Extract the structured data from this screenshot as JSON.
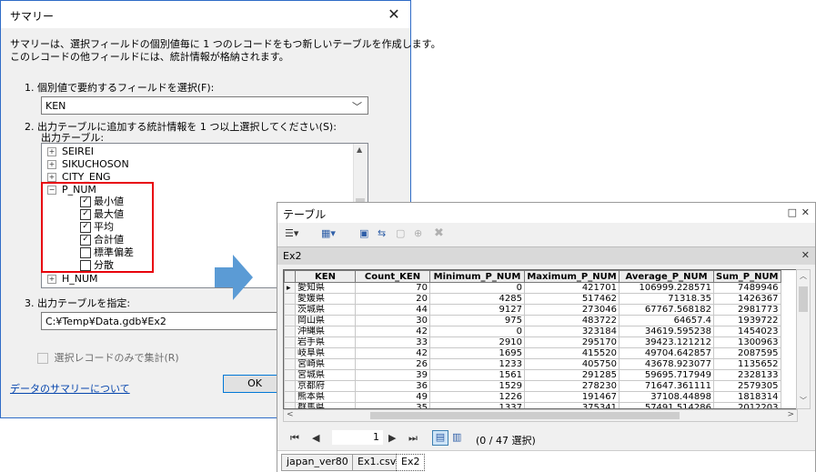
{
  "dialog": {
    "title": "サマリー",
    "desc_line1": "サマリーは、選択フィールドの個別値毎に 1 つのレコードをもつ新しいテーブルを作成します。",
    "desc_line2": "このレコードの他フィールドには、統計情報が格納されます。",
    "step1_label": "1. 個別値で要約するフィールドを選択(F):",
    "step1_value": "KEN",
    "step2_label": "2. 出力テーブルに追加する統計情報を 1 つ以上選択してください(S):",
    "step2_sublabel": "出力テーブル:",
    "tree": [
      {
        "label": "SEIREI",
        "expanded": false
      },
      {
        "label": "SIKUCHOSON",
        "expanded": false
      },
      {
        "label": "CITY_ENG",
        "expanded": false
      },
      {
        "label": "P_NUM",
        "expanded": true
      },
      {
        "label": "H_NUM",
        "expanded": false
      }
    ],
    "stats": [
      {
        "label": "最小値",
        "checked": true
      },
      {
        "label": "最大値",
        "checked": true
      },
      {
        "label": "平均",
        "checked": true
      },
      {
        "label": "合計値",
        "checked": true
      },
      {
        "label": "標準偏差",
        "checked": false
      },
      {
        "label": "分散",
        "checked": false
      }
    ],
    "step3_label": "3. 出力テーブルを指定:",
    "step3_value": "C:¥Temp¥Data.gdb¥Ex2",
    "selected_only_label": "選択レコードのみで集計(R)",
    "help_link": "データのサマリーについて",
    "ok_label": "OK",
    "highlight_color": "#e8000b"
  },
  "table_window": {
    "title": "テーブル",
    "tab_name": "Ex2",
    "columns": [
      "KEN",
      "Count_KEN",
      "Minimum_P_NUM",
      "Maximum_P_NUM",
      "Average_P_NUM",
      "Sum_P_NUM"
    ],
    "rows": [
      [
        "愛知県",
        "70",
        "0",
        "421701",
        "106999.228571",
        "7489946"
      ],
      [
        "愛媛県",
        "20",
        "4285",
        "517462",
        "71318.35",
        "1426367"
      ],
      [
        "茨城県",
        "44",
        "9127",
        "273046",
        "67767.568182",
        "2981773"
      ],
      [
        "岡山県",
        "30",
        "975",
        "483722",
        "64657.4",
        "1939722"
      ],
      [
        "沖縄県",
        "42",
        "0",
        "323184",
        "34619.595238",
        "1454023"
      ],
      [
        "岩手県",
        "33",
        "2910",
        "295170",
        "39423.121212",
        "1300963"
      ],
      [
        "岐阜県",
        "42",
        "1695",
        "415520",
        "49704.642857",
        "2087595"
      ],
      [
        "宮崎県",
        "26",
        "1233",
        "405750",
        "43678.923077",
        "1135652"
      ],
      [
        "宮城県",
        "39",
        "1561",
        "291285",
        "59695.717949",
        "2328133"
      ],
      [
        "京都府",
        "36",
        "1529",
        "278230",
        "71647.361111",
        "2579305"
      ],
      [
        "熊本県",
        "49",
        "1226",
        "191467",
        "37108.44898",
        "1818314"
      ],
      [
        "群馬県",
        "35",
        "1337",
        "375341",
        "57491.514286",
        "2012203"
      ]
    ],
    "page_value": "1",
    "selection_status": "(0 / 47 選択)",
    "bottom_tabs": [
      "japan_ver80",
      "Ex1.csv",
      "Ex2"
    ],
    "active_bottom_tab": "Ex2"
  }
}
